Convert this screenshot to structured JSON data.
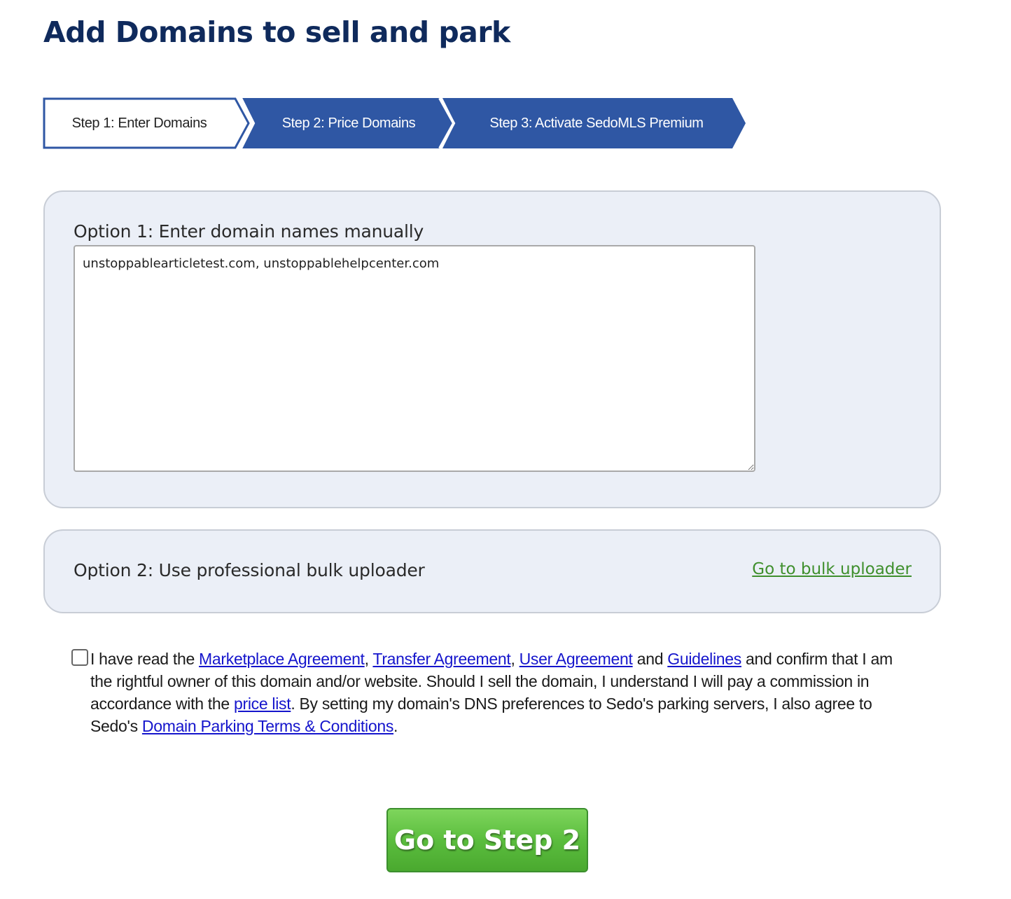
{
  "page": {
    "title": "Add Domains to sell and park"
  },
  "steps": [
    {
      "label": "Step 1: Enter Domains",
      "active": true
    },
    {
      "label": "Step 2: Price Domains",
      "active": false
    },
    {
      "label": "Step 3: Activate SedoMLS Premium",
      "active": false
    }
  ],
  "colors": {
    "step_active_bg": "#ffffff",
    "step_inactive_bg": "#2f57a4",
    "title": "#0f2a5c",
    "panel_bg": "#ebeff7",
    "link_green": "#3f8f2d",
    "link_blue": "#1515cc",
    "button_green": "#5bbd3e"
  },
  "option1": {
    "heading": "Option 1: Enter domain names manually",
    "textarea_value": "unstoppablearticletest.com, unstoppablehelpcenter.com"
  },
  "option2": {
    "heading": "Option 2: Use professional bulk uploader",
    "link": "Go to bulk uploader"
  },
  "agreement": {
    "checked": false,
    "text_1": "I have read the ",
    "link_marketplace": "Marketplace Agreement",
    "sep_1": ", ",
    "link_transfer": "Transfer Agreement",
    "sep_2": ", ",
    "link_user": "User Agreement",
    "text_2": " and ",
    "link_guidelines": "Guidelines",
    "text_3": " and confirm that I am the rightful owner of this domain and/or website. Should I sell the domain, I understand I will pay a commission in accordance with the ",
    "link_price": "price list",
    "text_4": ". By setting my domain's DNS preferences to Sedo's parking servers, I also agree to Sedo's ",
    "link_parking": "Domain Parking Terms & Conditions",
    "text_5": "."
  },
  "button": {
    "label": "Go to Step 2"
  }
}
